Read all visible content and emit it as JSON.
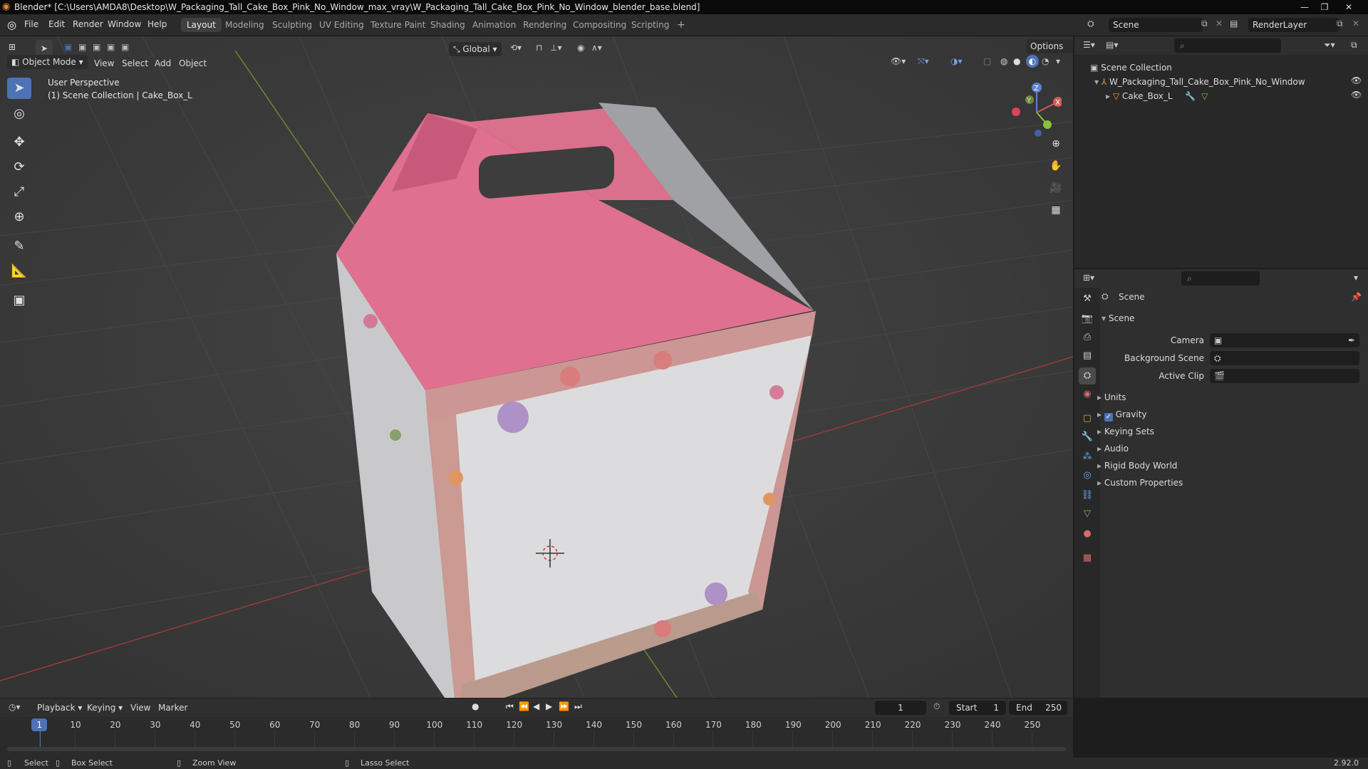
{
  "window": {
    "title": "Blender* [C:\\Users\\AMDA8\\Desktop\\W_Packaging_Tall_Cake_Box_Pink_No_Window_max_vray\\W_Packaging_Tall_Cake_Box_Pink_No_Window_blender_base.blend]",
    "minimize": "—",
    "maximize": "❐",
    "close": "✕"
  },
  "menu": [
    "File",
    "Edit",
    "Render",
    "Window",
    "Help"
  ],
  "workspaces": [
    "Layout",
    "Modeling",
    "Sculpting",
    "UV Editing",
    "Texture Paint",
    "Shading",
    "Animation",
    "Rendering",
    "Compositing",
    "Scripting",
    "+"
  ],
  "active_workspace": "Layout",
  "scene_field": "Scene",
  "renderlayer_field": "RenderLayer",
  "viewport": {
    "mode": "Object Mode",
    "menus": [
      "View",
      "Select",
      "Add",
      "Object"
    ],
    "transform_orientation": "Global",
    "options_label": "Options",
    "info_line1": "User Perspective",
    "info_line2": "(1) Scene Collection | Cake_Box_L",
    "gizmo_x": "X",
    "gizmo_y": "Y",
    "gizmo_z": "Z"
  },
  "outliner": {
    "root": "Scene Collection",
    "items": [
      {
        "label": "W_Packaging_Tall_Cake_Box_Pink_No_Window"
      },
      {
        "label": "Cake_Box_L"
      }
    ]
  },
  "properties": {
    "breadcrumb": "Scene",
    "panel_title": "Scene",
    "fields": [
      {
        "label": "Camera"
      },
      {
        "label": "Background Scene"
      },
      {
        "label": "Active Clip"
      }
    ],
    "sections": [
      "Units",
      "Gravity",
      "Keying Sets",
      "Audio",
      "Rigid Body World",
      "Custom Properties"
    ],
    "gravity_checked": true
  },
  "timeline": {
    "menus": [
      "Playback",
      "Keying",
      "View",
      "Marker"
    ],
    "current_frame": "1",
    "start_label": "Start",
    "start_value": "1",
    "end_label": "End",
    "end_value": "250",
    "ticks": [
      "1",
      "10",
      "20",
      "30",
      "40",
      "50",
      "60",
      "70",
      "80",
      "90",
      "100",
      "110",
      "120",
      "130",
      "140",
      "150",
      "160",
      "170",
      "180",
      "190",
      "200",
      "210",
      "220",
      "230",
      "240",
      "250"
    ]
  },
  "status": {
    "select": "Select",
    "box_select": "Box Select",
    "zoom_view": "Zoom View",
    "lasso_select": "Lasso Select",
    "version": "2.92.0"
  },
  "colors": {
    "accent": "#4d72b5",
    "box_pink": "#e0708f",
    "box_white": "#dcdcde",
    "grid_red": "#9a3b3b",
    "grid_green": "#6b8a2f"
  }
}
